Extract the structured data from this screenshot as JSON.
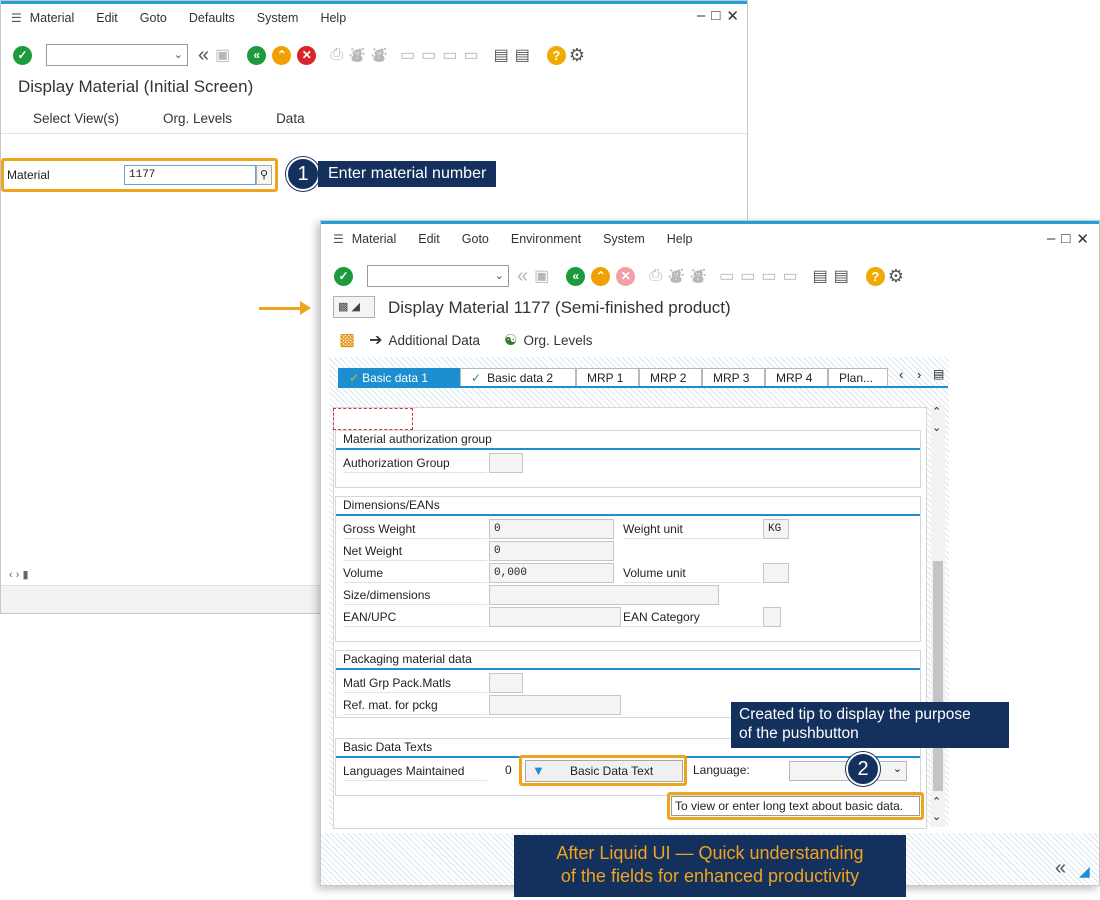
{
  "window1": {
    "menu": [
      "Material",
      "Edit",
      "Goto",
      "Defaults",
      "System",
      "Help"
    ],
    "title": "Display Material (Initial Screen)",
    "app_toolbar": [
      "Select View(s)",
      "Org. Levels",
      "Data"
    ],
    "material_label": "Material",
    "material_value": "1177"
  },
  "window2": {
    "menu": [
      "Material",
      "Edit",
      "Goto",
      "Environment",
      "System",
      "Help"
    ],
    "title": "Display Material 1177 (Semi-finished product)",
    "app_toolbar": {
      "additional_data": "Additional Data",
      "org_levels": "Org. Levels"
    },
    "tabs": [
      "Basic data 1",
      "Basic data 2",
      "MRP 1",
      "MRP 2",
      "MRP 3",
      "MRP 4",
      "Plan..."
    ],
    "groups": {
      "auth": {
        "title": "Material authorization group",
        "authorization_group": "Authorization Group"
      },
      "dims": {
        "title": "Dimensions/EANs",
        "gross_weight": "Gross Weight",
        "gross_weight_value": "0",
        "weight_unit": "Weight unit",
        "weight_unit_value": "KG",
        "net_weight": "Net Weight",
        "net_weight_value": "0",
        "volume": "Volume",
        "volume_value": "0,000",
        "volume_unit": "Volume unit",
        "size_dimensions": "Size/dimensions",
        "ean_upc": "EAN/UPC",
        "ean_category": "EAN Category"
      },
      "pack": {
        "title": "Packaging material data",
        "matl_grp": "Matl Grp Pack.Matls",
        "ref_mat": "Ref. mat. for pckg"
      },
      "texts": {
        "title": "Basic Data Texts",
        "languages_maintained": "Languages Maintained",
        "languages_count": "0",
        "basic_data_text_button": "Basic Data Text",
        "language": "Language:"
      }
    },
    "tooltip": "To view or enter long text about basic data."
  },
  "callouts": {
    "step1_number": "1",
    "step1_text": "Enter material number",
    "step2_number": "2",
    "step2_text_line1": "Created tip to display the purpose",
    "step2_text_line2": "of the pushbutton",
    "banner_line1": "After Liquid UI — Quick understanding",
    "banner_line2": "of the fields for enhanced productivity"
  },
  "colors": {
    "accent_blue": "#1d8fd0",
    "navy": "#14305c",
    "orange": "#f0a41e"
  }
}
